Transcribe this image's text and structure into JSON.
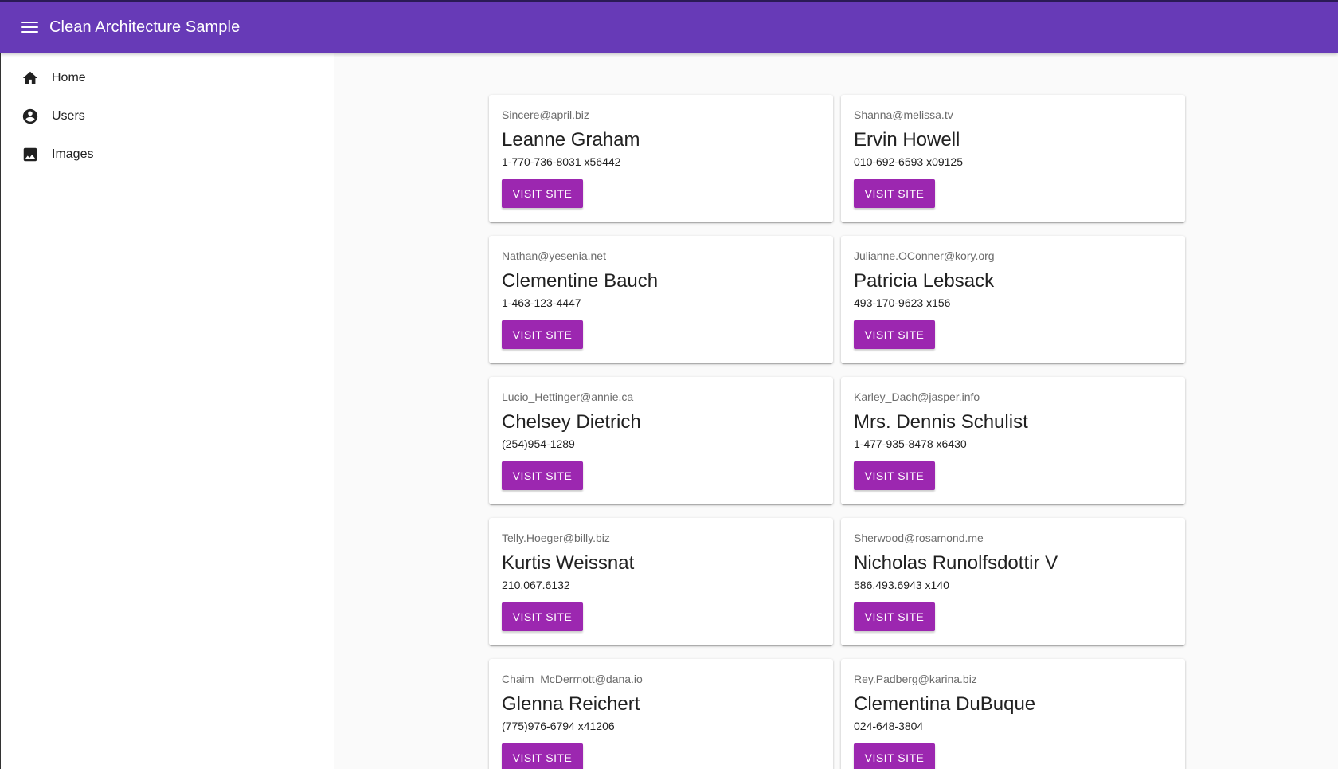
{
  "app": {
    "title": "Clean Architecture Sample"
  },
  "colors": {
    "appbar": "#673ab7",
    "button": "#9c27b0"
  },
  "sidebar": {
    "items": [
      {
        "label": "Home",
        "icon": "home-icon"
      },
      {
        "label": "Users",
        "icon": "account-circle-icon"
      },
      {
        "label": "Images",
        "icon": "image-icon"
      }
    ]
  },
  "users": [
    {
      "email": "Sincere@april.biz",
      "name": "Leanne Graham",
      "phone": "1-770-736-8031 x56442",
      "button": "VISIT SITE"
    },
    {
      "email": "Shanna@melissa.tv",
      "name": "Ervin Howell",
      "phone": "010-692-6593 x09125",
      "button": "VISIT SITE"
    },
    {
      "email": "Nathan@yesenia.net",
      "name": "Clementine Bauch",
      "phone": "1-463-123-4447",
      "button": "VISIT SITE"
    },
    {
      "email": "Julianne.OConner@kory.org",
      "name": "Patricia Lebsack",
      "phone": "493-170-9623 x156",
      "button": "VISIT SITE"
    },
    {
      "email": "Lucio_Hettinger@annie.ca",
      "name": "Chelsey Dietrich",
      "phone": "(254)954-1289",
      "button": "VISIT SITE"
    },
    {
      "email": "Karley_Dach@jasper.info",
      "name": "Mrs. Dennis Schulist",
      "phone": "1-477-935-8478 x6430",
      "button": "VISIT SITE"
    },
    {
      "email": "Telly.Hoeger@billy.biz",
      "name": "Kurtis Weissnat",
      "phone": "210.067.6132",
      "button": "VISIT SITE"
    },
    {
      "email": "Sherwood@rosamond.me",
      "name": "Nicholas Runolfsdottir V",
      "phone": "586.493.6943 x140",
      "button": "VISIT SITE"
    },
    {
      "email": "Chaim_McDermott@dana.io",
      "name": "Glenna Reichert",
      "phone": "(775)976-6794 x41206",
      "button": "VISIT SITE"
    },
    {
      "email": "Rey.Padberg@karina.biz",
      "name": "Clementina DuBuque",
      "phone": "024-648-3804",
      "button": "VISIT SITE"
    }
  ]
}
